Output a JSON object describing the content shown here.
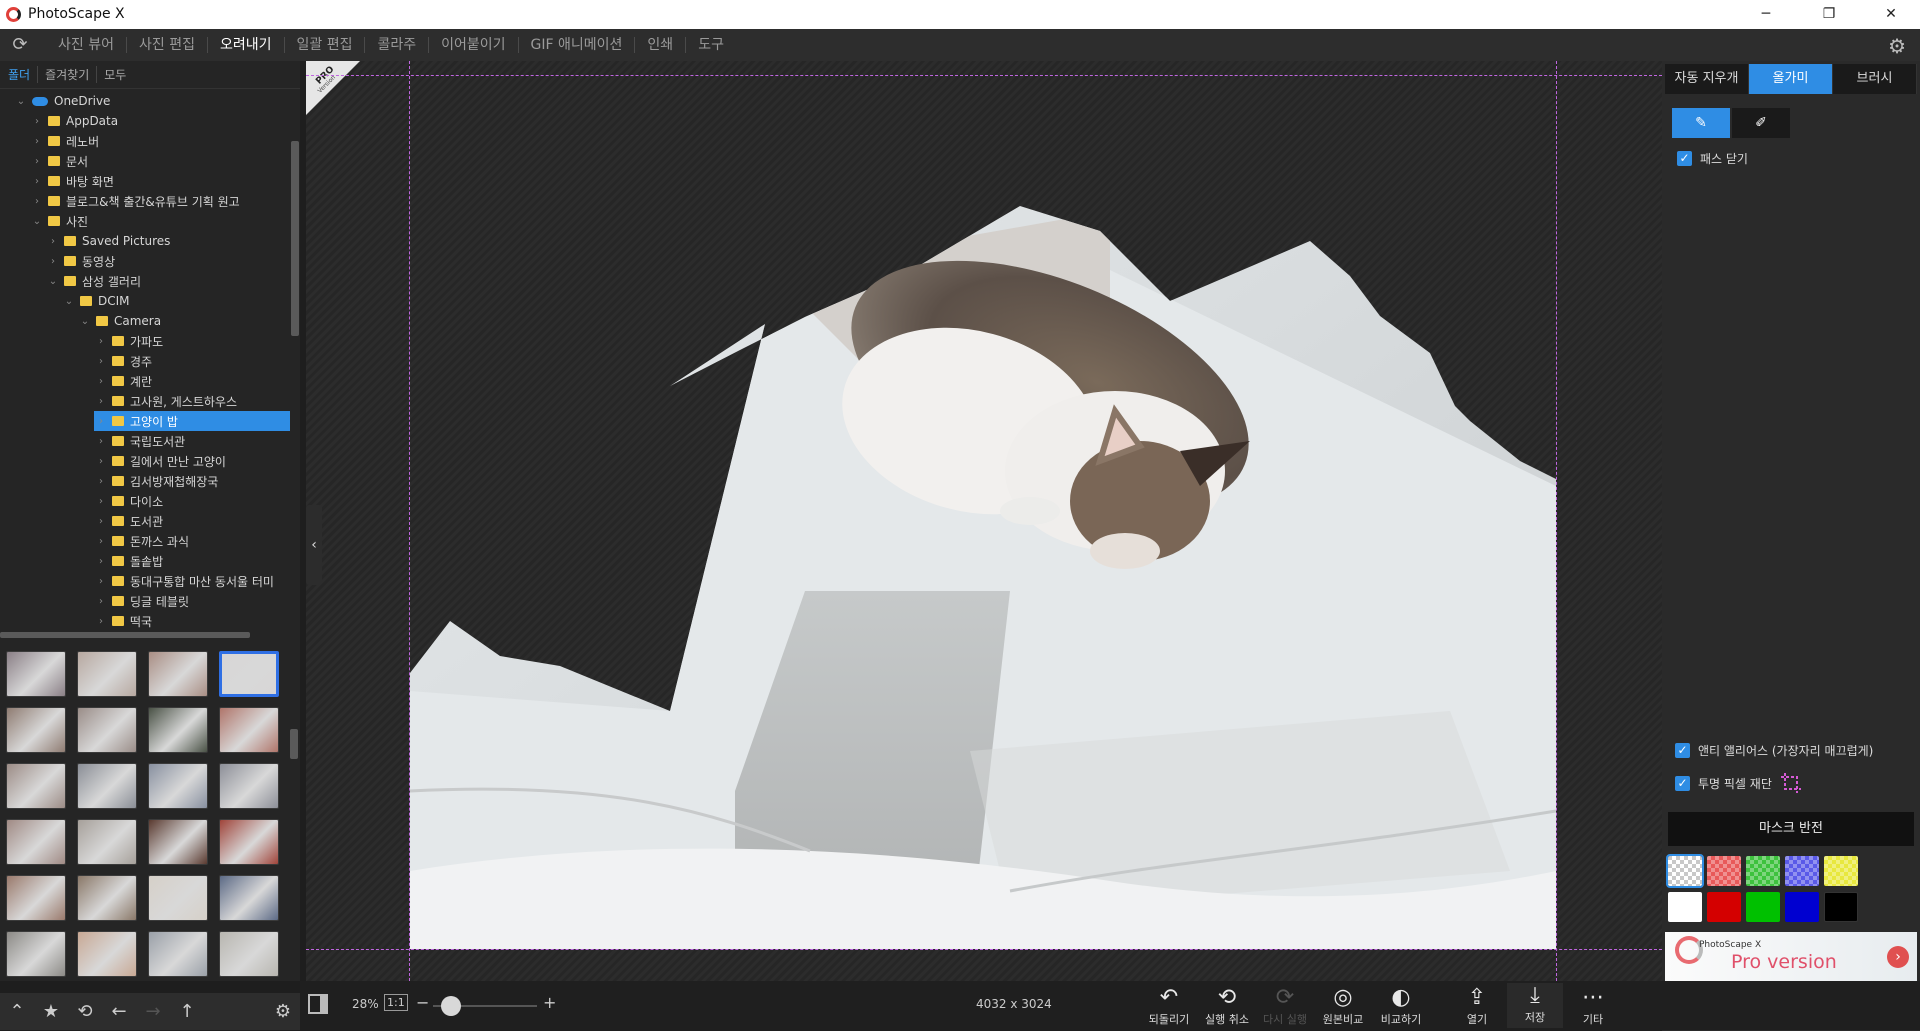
{
  "app": {
    "title": "PhotoScape X",
    "window_buttons": [
      "─",
      "❐",
      "✕"
    ]
  },
  "menu": {
    "tabs": [
      "사진 뷰어",
      "사진 편집",
      "오려내기",
      "일괄 편집",
      "콜라주",
      "이어붙이기",
      "GIF 애니메이션",
      "인쇄",
      "도구"
    ],
    "active_index": 2
  },
  "left_panel": {
    "tabs": [
      "폴더",
      "즐겨찾기",
      "모두"
    ],
    "active_tab": 0,
    "tree": [
      {
        "label": "OneDrive",
        "depth": 0,
        "expanded": true,
        "icon": "cloud-icon"
      },
      {
        "label": "AppData",
        "depth": 1,
        "expanded": false,
        "icon": "folder-icon"
      },
      {
        "label": "레노버",
        "depth": 1,
        "expanded": false,
        "icon": "folder-icon"
      },
      {
        "label": "문서",
        "depth": 1,
        "expanded": false,
        "icon": "folder-icon"
      },
      {
        "label": "바탕 화면",
        "depth": 1,
        "expanded": false,
        "icon": "folder-icon"
      },
      {
        "label": "블로그&책 출간&유튜브 기획 원고",
        "depth": 1,
        "expanded": false,
        "icon": "folder-icon"
      },
      {
        "label": "사진",
        "depth": 1,
        "expanded": true,
        "icon": "folder-icon"
      },
      {
        "label": "Saved Pictures",
        "depth": 2,
        "expanded": false,
        "icon": "folder-icon"
      },
      {
        "label": "동영상",
        "depth": 2,
        "expanded": false,
        "icon": "folder-icon"
      },
      {
        "label": "삼성 갤러리",
        "depth": 2,
        "expanded": true,
        "icon": "folder-icon"
      },
      {
        "label": "DCIM",
        "depth": 3,
        "expanded": true,
        "icon": "folder-icon"
      },
      {
        "label": "Camera",
        "depth": 4,
        "expanded": true,
        "icon": "folder-icon"
      },
      {
        "label": "가파도",
        "depth": 5,
        "expanded": false,
        "icon": "folder-icon"
      },
      {
        "label": "경주",
        "depth": 5,
        "expanded": false,
        "icon": "folder-icon"
      },
      {
        "label": "계란",
        "depth": 5,
        "expanded": false,
        "icon": "folder-icon"
      },
      {
        "label": "고사원, 게스트하우스",
        "depth": 5,
        "expanded": false,
        "icon": "folder-icon"
      },
      {
        "label": "고양이 밥",
        "depth": 5,
        "expanded": false,
        "icon": "folder-icon",
        "selected": true
      },
      {
        "label": "국립도서관",
        "depth": 5,
        "expanded": false,
        "icon": "folder-icon"
      },
      {
        "label": "길에서 만난 고양이",
        "depth": 5,
        "expanded": false,
        "icon": "folder-icon"
      },
      {
        "label": "김서방재첩해장국",
        "depth": 5,
        "expanded": false,
        "icon": "folder-icon"
      },
      {
        "label": "다이소",
        "depth": 5,
        "expanded": false,
        "icon": "folder-icon"
      },
      {
        "label": "도서관",
        "depth": 5,
        "expanded": false,
        "icon": "folder-icon"
      },
      {
        "label": "돈까스 과식",
        "depth": 5,
        "expanded": false,
        "icon": "folder-icon"
      },
      {
        "label": "돌솥밥",
        "depth": 5,
        "expanded": false,
        "icon": "folder-icon"
      },
      {
        "label": "동대구통합 마산 동서울 터미",
        "depth": 5,
        "expanded": false,
        "icon": "folder-icon"
      },
      {
        "label": "딩글 테블릿",
        "depth": 5,
        "expanded": false,
        "icon": "folder-icon"
      },
      {
        "label": "떡국",
        "depth": 5,
        "expanded": false,
        "icon": "folder-icon"
      }
    ],
    "thumbnail_colors": [
      [
        "#8a7f86",
        "#b7a8a0",
        "#a98e84",
        "#d8d6d6"
      ],
      [
        "#8f7c72",
        "#9a8d88",
        "#4a5246",
        "#b0756a"
      ],
      [
        "#9c8c86",
        "#8a8e96",
        "#8890a0",
        "#8d8f98"
      ],
      [
        "#a08a84",
        "#a6a09a",
        "#5a3a30",
        "#a0443a"
      ],
      [
        "#9a7a6c",
        "#8a7868",
        "#d6d0c8",
        "#5c6a86"
      ],
      [
        "#8c8a86",
        "#c8a894",
        "#9aa0a8",
        "#b8b6b0"
      ],
      [
        "#8a9078",
        "#b0a6a0",
        "#a86a64",
        "#4e8a3c"
      ]
    ],
    "selected_thumb": [
      0,
      3
    ]
  },
  "right_panel": {
    "mode_tabs": [
      "자동 지우개",
      "올가미",
      "브러시"
    ],
    "active_mode": 1,
    "tools": [
      "brush-add-icon",
      "brush-erase-icon"
    ],
    "close_path_label": "패스 닫기",
    "close_path_checked": true,
    "antialias_label": "앤티 앨리어스 (가장자리 매끄럽게)",
    "antialias_checked": true,
    "trim_label": "투명 픽셀 재단",
    "trim_checked": true,
    "mask_invert_label": "마스크 반전",
    "bg_swatches": [
      "checker",
      "#e85a5a",
      "#3ec23e",
      "#5a5ae8",
      "#e8e83e",
      "#ffffff",
      "#d40000",
      "#00c000",
      "#0000d0",
      "#000000"
    ],
    "promo_small": "PhotoScape X",
    "promo_big": "Pro version"
  },
  "status": {
    "zoom": "28%",
    "one_to_one": "1:1",
    "image_size": "4032 x 3024",
    "zoom_level": 0.08,
    "actions": [
      {
        "icon": "↶",
        "label": "되돌리기",
        "enabled": true
      },
      {
        "icon": "⟲",
        "label": "실행 취소",
        "enabled": true
      },
      {
        "icon": "⟳",
        "label": "다시 실행",
        "enabled": false
      },
      {
        "icon": "◎",
        "label": "원본비교",
        "enabled": true
      },
      {
        "icon": "◐",
        "label": "비교하기",
        "enabled": true
      },
      {
        "icon": "⇪",
        "label": "열기",
        "enabled": true
      },
      {
        "icon": "⤓",
        "label": "저장",
        "enabled": true
      },
      {
        "icon": "⋯",
        "label": "기타",
        "enabled": true
      }
    ]
  },
  "badge": {
    "pro": "PRO",
    "version": "Version"
  }
}
